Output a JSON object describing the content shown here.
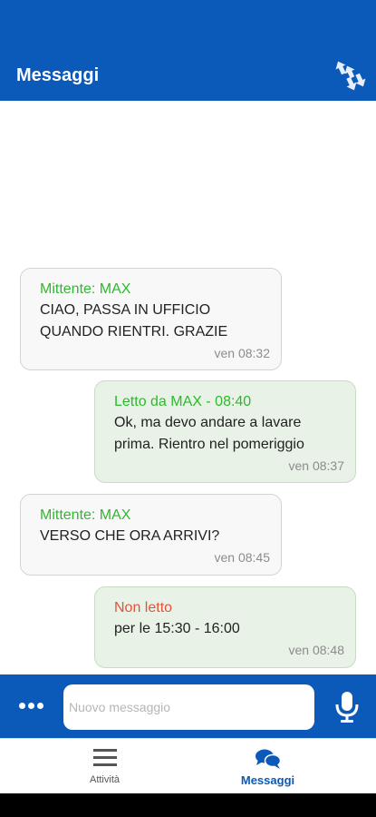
{
  "header": {
    "title": "Messaggi",
    "action_icon": "swap-arrows-icon"
  },
  "messages": [
    {
      "direction": "in",
      "header": "Mittente: MAX",
      "header_color": "#2eb82e",
      "text_lines": [
        "CIAO, PASSA IN UFFICIO",
        "QUANDO RIENTRI. GRAZIE"
      ],
      "time": "ven 08:32"
    },
    {
      "direction": "out",
      "header": "Letto da MAX - 08:40",
      "header_color": "#2eb82e",
      "text_lines": [
        "Ok, ma devo andare a lavare",
        "prima. Rientro nel pomeriggio"
      ],
      "time": "ven 08:37"
    },
    {
      "direction": "in",
      "header": "Mittente: MAX",
      "header_color": "#2eb82e",
      "text_lines": [
        "VERSO CHE ORA ARRIVI?"
      ],
      "time": "ven 08:45"
    },
    {
      "direction": "out",
      "header": "Non letto",
      "header_color": "#e0533d",
      "text_lines": [
        "per le 15:30 - 16:00"
      ],
      "time": "ven 08:48"
    }
  ],
  "composer": {
    "placeholder": "Nuovo messaggio",
    "more_icon": "more-dots-icon",
    "mic_icon": "microphone-icon"
  },
  "bottom_nav": [
    {
      "label": "Attività",
      "icon": "menu-icon",
      "active": false
    },
    {
      "label": "Messaggi",
      "icon": "chat-bubbles-icon",
      "active": true
    }
  ],
  "colors": {
    "brand": "#0b59b8",
    "incoming_bg": "#f8f8f8",
    "outgoing_bg": "#e8f2e6",
    "read_green": "#2eb82e",
    "unread_red": "#e0533d"
  }
}
